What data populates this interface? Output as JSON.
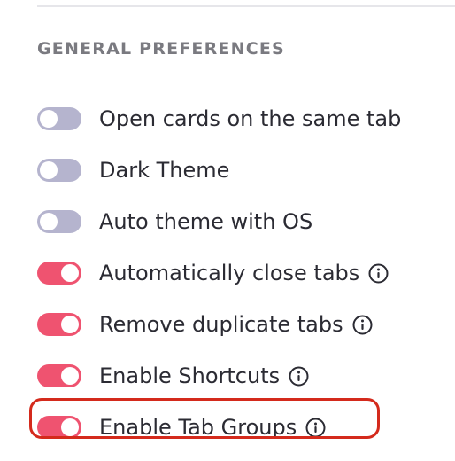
{
  "section": {
    "title": "GENERAL PREFERENCES"
  },
  "preferences": [
    {
      "label": "Open cards on the same tab",
      "enabled": false,
      "has_info": false
    },
    {
      "label": "Dark Theme",
      "enabled": false,
      "has_info": false
    },
    {
      "label": "Auto theme with OS",
      "enabled": false,
      "has_info": false
    },
    {
      "label": "Automatically close tabs",
      "enabled": true,
      "has_info": true
    },
    {
      "label": "Remove duplicate tabs",
      "enabled": true,
      "has_info": true
    },
    {
      "label": "Enable Shortcuts",
      "enabled": true,
      "has_info": true
    },
    {
      "label": "Enable Tab Groups",
      "enabled": true,
      "has_info": true,
      "highlighted": true
    }
  ],
  "colors": {
    "toggle_on": "#ef5370",
    "toggle_off": "#b5b4ce",
    "highlight_border": "#d42a1c",
    "section_title": "#7a7a80",
    "label_text": "#2b2b33"
  },
  "icons": {
    "info": "info-circle-icon"
  }
}
